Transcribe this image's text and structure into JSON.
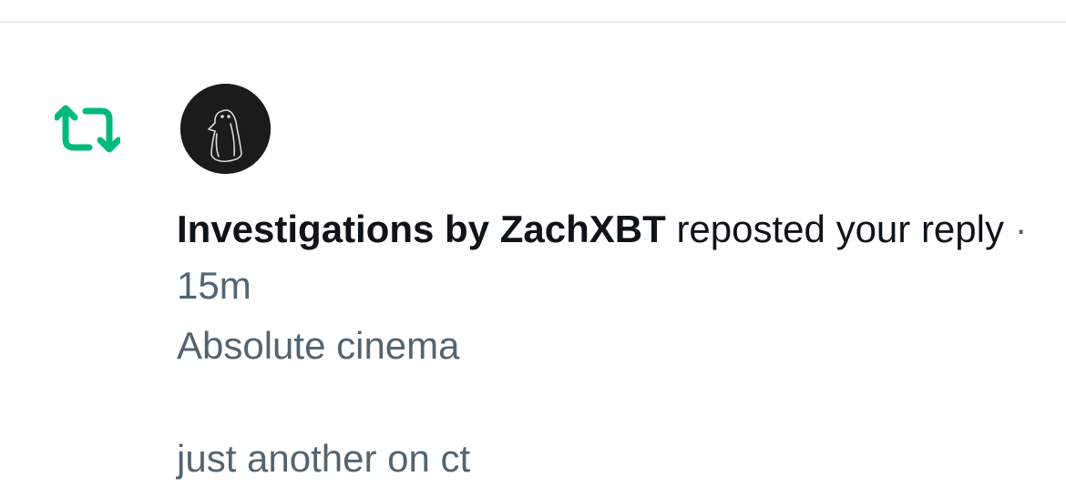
{
  "notification": {
    "type_icon": "repost-icon",
    "avatar_icon": "penguin-avatar",
    "actor_name": "Investigations by ZachXBT",
    "action_text": " reposted your reply",
    "separator": " · ",
    "time_ago": "15m",
    "reply_lines": [
      "Absolute cinema",
      "",
      "just another on ct"
    ]
  },
  "colors": {
    "repost_green": "#00ba7c",
    "primary_text": "#0f1419",
    "secondary_text": "#536471",
    "avatar_bg": "#1b1b1b",
    "divider": "#eceef0"
  }
}
